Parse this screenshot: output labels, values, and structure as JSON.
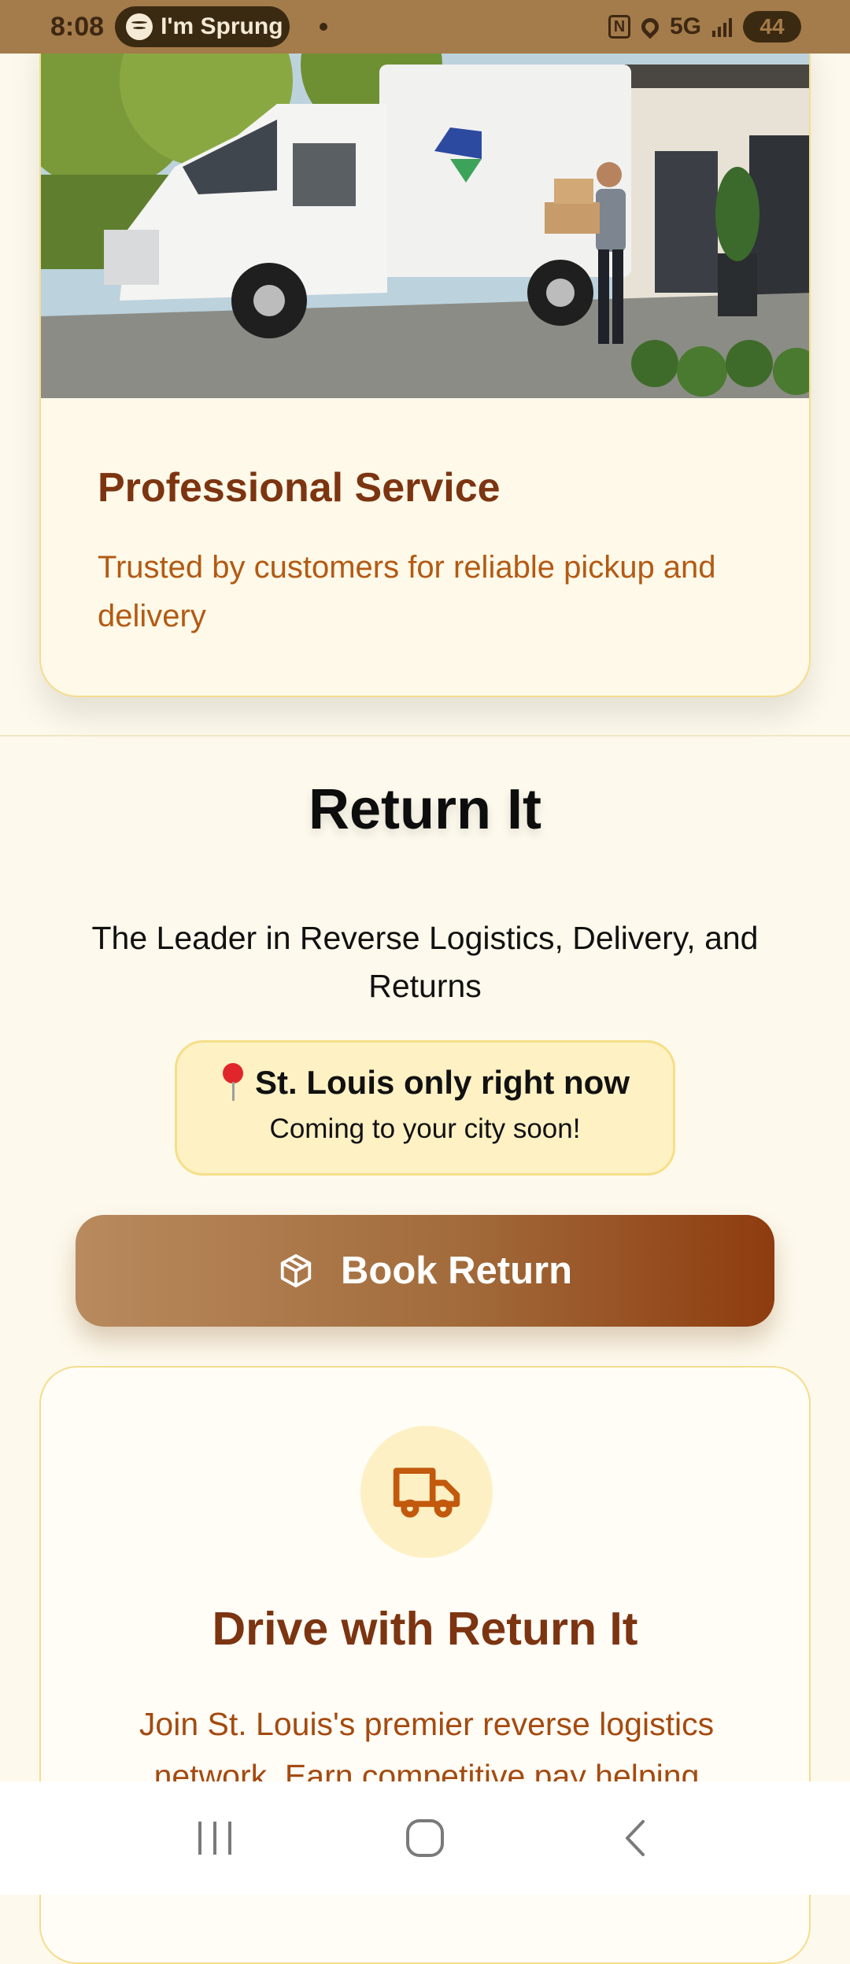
{
  "status_bar": {
    "time": "8:08",
    "media_text": "I'm Sprung",
    "network": "5G",
    "battery": "44"
  },
  "hero": {
    "title": "Professional Service",
    "subtitle": "Trusted by customers for reliable pickup and delivery"
  },
  "main": {
    "title": "Return It",
    "tagline": "The Leader in Reverse Logistics, Delivery, and Returns",
    "location_title": "St. Louis only right now",
    "location_sub": "Coming to your city soon!",
    "book_button_label": "Book Return"
  },
  "drive": {
    "title": "Drive with Return It",
    "text": "Join St. Louis's premier reverse logistics network. Earn competitive pay helping"
  },
  "nav": {
    "items": [
      "recent-apps",
      "home",
      "back"
    ]
  },
  "colors": {
    "status_bar": "#a47b4a",
    "brand_brown": "#7c3411",
    "brand_orange": "#b35a14",
    "cream": "#fdf9ec",
    "card_border": "#f5dd8e"
  }
}
